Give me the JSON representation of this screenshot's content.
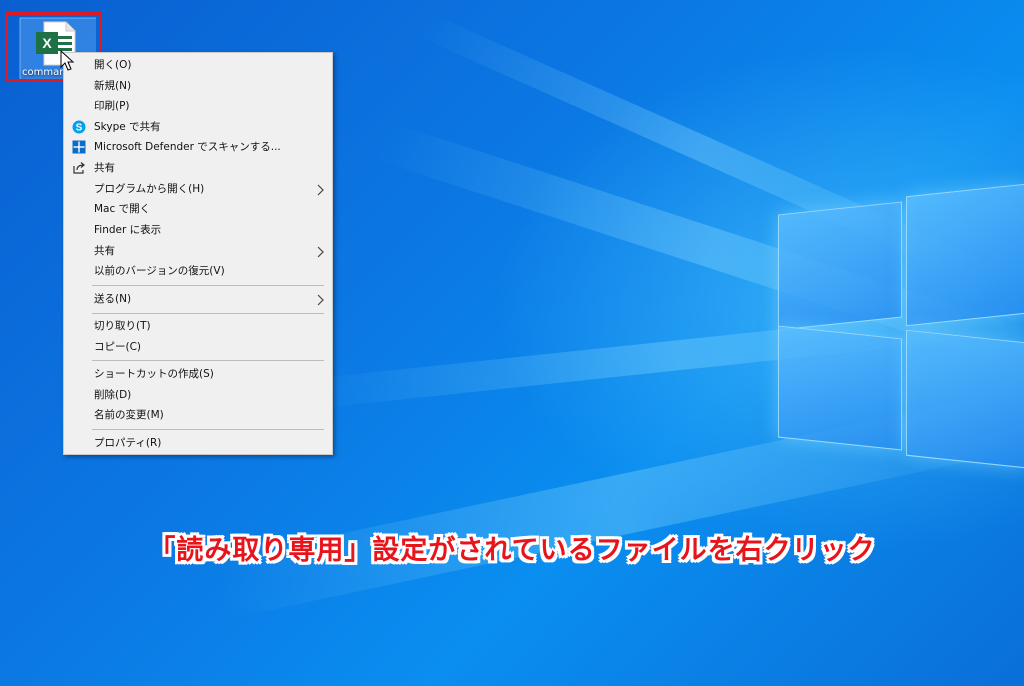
{
  "desktop": {
    "file": {
      "name": "commar",
      "type_icon": "excel-icon"
    }
  },
  "context_menu": {
    "items": [
      {
        "label": "開く(O)",
        "icon": "",
        "submenu": false
      },
      {
        "label": "新規(N)",
        "icon": "",
        "submenu": false
      },
      {
        "label": "印刷(P)",
        "icon": "",
        "submenu": false
      },
      {
        "label": "Skype で共有",
        "icon": "skype-icon",
        "submenu": false
      },
      {
        "label": "Microsoft Defender でスキャンする...",
        "icon": "defender-icon",
        "submenu": false
      },
      {
        "label": "共有",
        "icon": "share-icon",
        "submenu": false
      },
      {
        "label": "プログラムから開く(H)",
        "icon": "",
        "submenu": true
      },
      {
        "label": "Mac で開く",
        "icon": "",
        "submenu": false
      },
      {
        "label": "Finder に表示",
        "icon": "",
        "submenu": false
      },
      {
        "label": "共有",
        "icon": "",
        "submenu": true
      },
      {
        "label": "以前のバージョンの復元(V)",
        "icon": "",
        "submenu": false
      },
      {
        "label": "送る(N)",
        "icon": "",
        "submenu": true
      },
      {
        "label": "切り取り(T)",
        "icon": "",
        "submenu": false
      },
      {
        "label": "コピー(C)",
        "icon": "",
        "submenu": false
      },
      {
        "label": "ショートカットの作成(S)",
        "icon": "",
        "submenu": false
      },
      {
        "label": "削除(D)",
        "icon": "",
        "submenu": false
      },
      {
        "label": "名前の変更(M)",
        "icon": "",
        "submenu": false
      },
      {
        "label": "プロパティ(R)",
        "icon": "",
        "submenu": false
      }
    ]
  },
  "caption": {
    "text": "「読み取り専用」設定がされているファイルを右クリック",
    "color": "#e8141c"
  },
  "colors": {
    "highlight_box": "#e01a22",
    "excel_green": "#1e7145",
    "skype_blue": "#00a2ed",
    "defender_blue": "#0a6bc9"
  }
}
